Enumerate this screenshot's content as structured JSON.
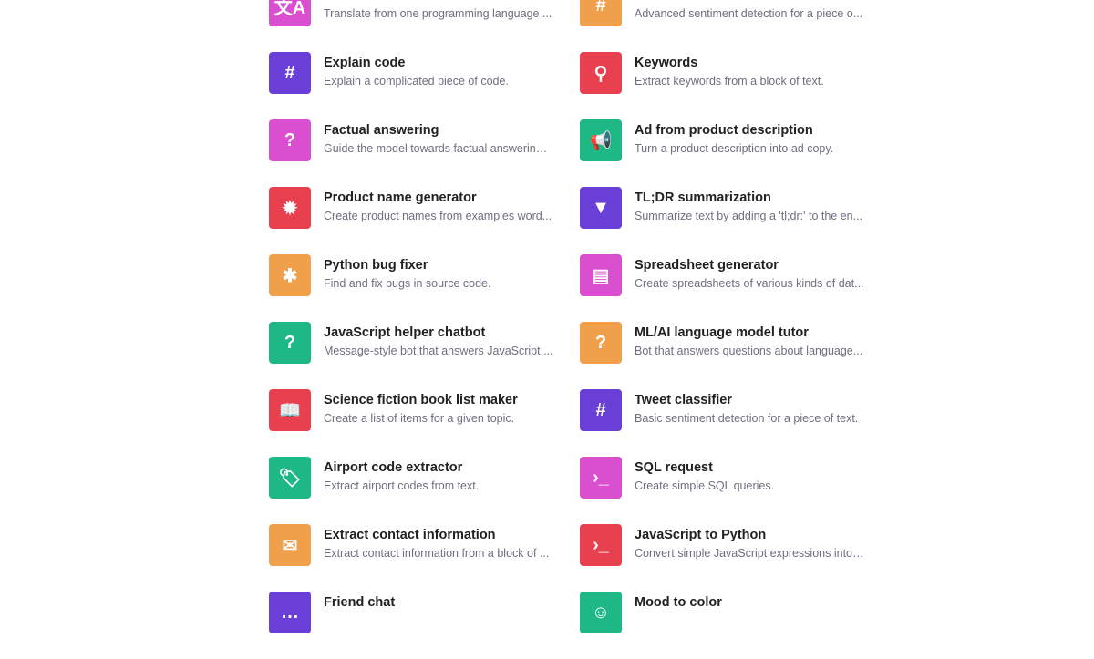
{
  "colors": {
    "magenta": "#d94fcf",
    "orange": "#f0a04b",
    "purple": "#6a3fd8",
    "red": "#e8404f",
    "green": "#1db885"
  },
  "items": [
    {
      "title": "",
      "desc": "Translate from one programming language ...",
      "color": "#d94fcf",
      "icon": "translate-icon",
      "glyph": "文A"
    },
    {
      "title": "",
      "desc": "Advanced sentiment detection for a piece o...",
      "color": "#f0a04b",
      "icon": "hashtag-icon",
      "glyph": "#"
    },
    {
      "title": "Explain code",
      "desc": "Explain a complicated piece of code.",
      "color": "#6a3fd8",
      "icon": "hashtag-icon",
      "glyph": "#"
    },
    {
      "title": "Keywords",
      "desc": "Extract keywords from a block of text.",
      "color": "#e8404f",
      "icon": "key-icon",
      "glyph": "⚲"
    },
    {
      "title": "Factual answering",
      "desc": "Guide the model towards factual answering ...",
      "color": "#d94fcf",
      "icon": "question-icon",
      "glyph": "?"
    },
    {
      "title": "Ad from product description",
      "desc": "Turn a product description into ad copy.",
      "color": "#1db885",
      "icon": "megaphone-icon",
      "glyph": "📢"
    },
    {
      "title": "Product name generator",
      "desc": "Create product names from examples word...",
      "color": "#e8404f",
      "icon": "lightbulb-icon",
      "glyph": "✹"
    },
    {
      "title": "TL;DR summarization",
      "desc": "Summarize text by adding a 'tl;dr:' to the en...",
      "color": "#6a3fd8",
      "icon": "filter-icon",
      "glyph": "▼"
    },
    {
      "title": "Python bug fixer",
      "desc": "Find and fix bugs in source code.",
      "color": "#f0a04b",
      "icon": "bug-icon",
      "glyph": "✱"
    },
    {
      "title": "Spreadsheet generator",
      "desc": "Create spreadsheets of various kinds of dat...",
      "color": "#d94fcf",
      "icon": "table-icon",
      "glyph": "▤"
    },
    {
      "title": "JavaScript helper chatbot",
      "desc": "Message-style bot that answers JavaScript ...",
      "color": "#1db885",
      "icon": "question-icon",
      "glyph": "?"
    },
    {
      "title": "ML/AI language model tutor",
      "desc": "Bot that answers questions about language...",
      "color": "#f0a04b",
      "icon": "question-icon",
      "glyph": "?"
    },
    {
      "title": "Science fiction book list maker",
      "desc": "Create a list of items for a given topic.",
      "color": "#e8404f",
      "icon": "book-icon",
      "glyph": "📖"
    },
    {
      "title": "Tweet classifier",
      "desc": "Basic sentiment detection for a piece of text.",
      "color": "#6a3fd8",
      "icon": "hashtag-icon",
      "glyph": "#"
    },
    {
      "title": "Airport code extractor",
      "desc": "Extract airport codes from text.",
      "color": "#1db885",
      "icon": "tag-icon",
      "glyph": "🏷"
    },
    {
      "title": "SQL request",
      "desc": "Create simple SQL queries.",
      "color": "#d94fcf",
      "icon": "terminal-icon",
      "glyph": "›_"
    },
    {
      "title": "Extract contact information",
      "desc": "Extract contact information from a block of ...",
      "color": "#f0a04b",
      "icon": "envelope-icon",
      "glyph": "✉"
    },
    {
      "title": "JavaScript to Python",
      "desc": "Convert simple JavaScript expressions into ...",
      "color": "#e8404f",
      "icon": "terminal-icon",
      "glyph": "›_"
    },
    {
      "title": "Friend chat",
      "desc": "",
      "color": "#6a3fd8",
      "icon": "chat-icon",
      "glyph": "…"
    },
    {
      "title": "Mood to color",
      "desc": "",
      "color": "#1db885",
      "icon": "smiley-icon",
      "glyph": "☺"
    }
  ]
}
